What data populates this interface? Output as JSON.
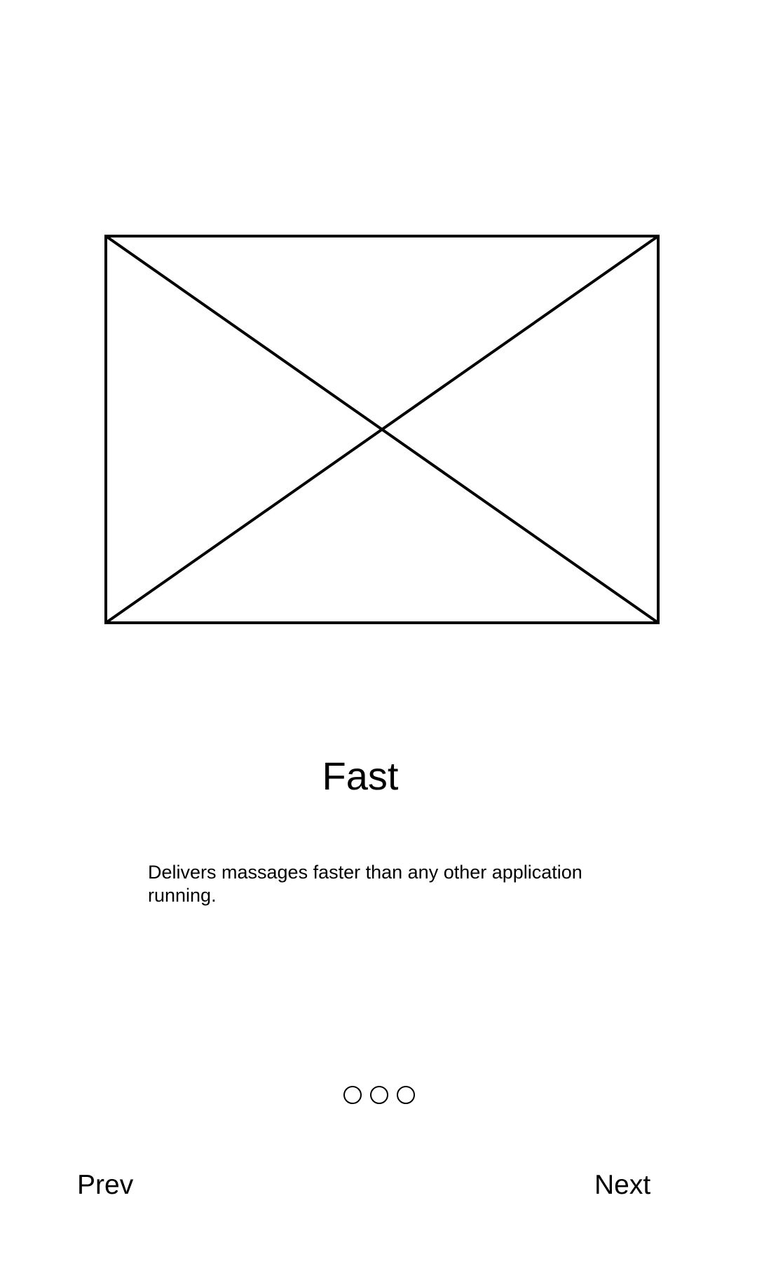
{
  "onboarding": {
    "title": "Fast",
    "description": "Delivers massages faster than any other application running.",
    "page_indicator": {
      "count": 3
    },
    "prev_label": "Prev",
    "next_label": "Next"
  },
  "colors": {
    "background": "#ffffff",
    "foreground": "#000000"
  },
  "icons": {
    "image_placeholder": "image-placeholder-icon",
    "page_dot": "circle-outline-icon"
  }
}
